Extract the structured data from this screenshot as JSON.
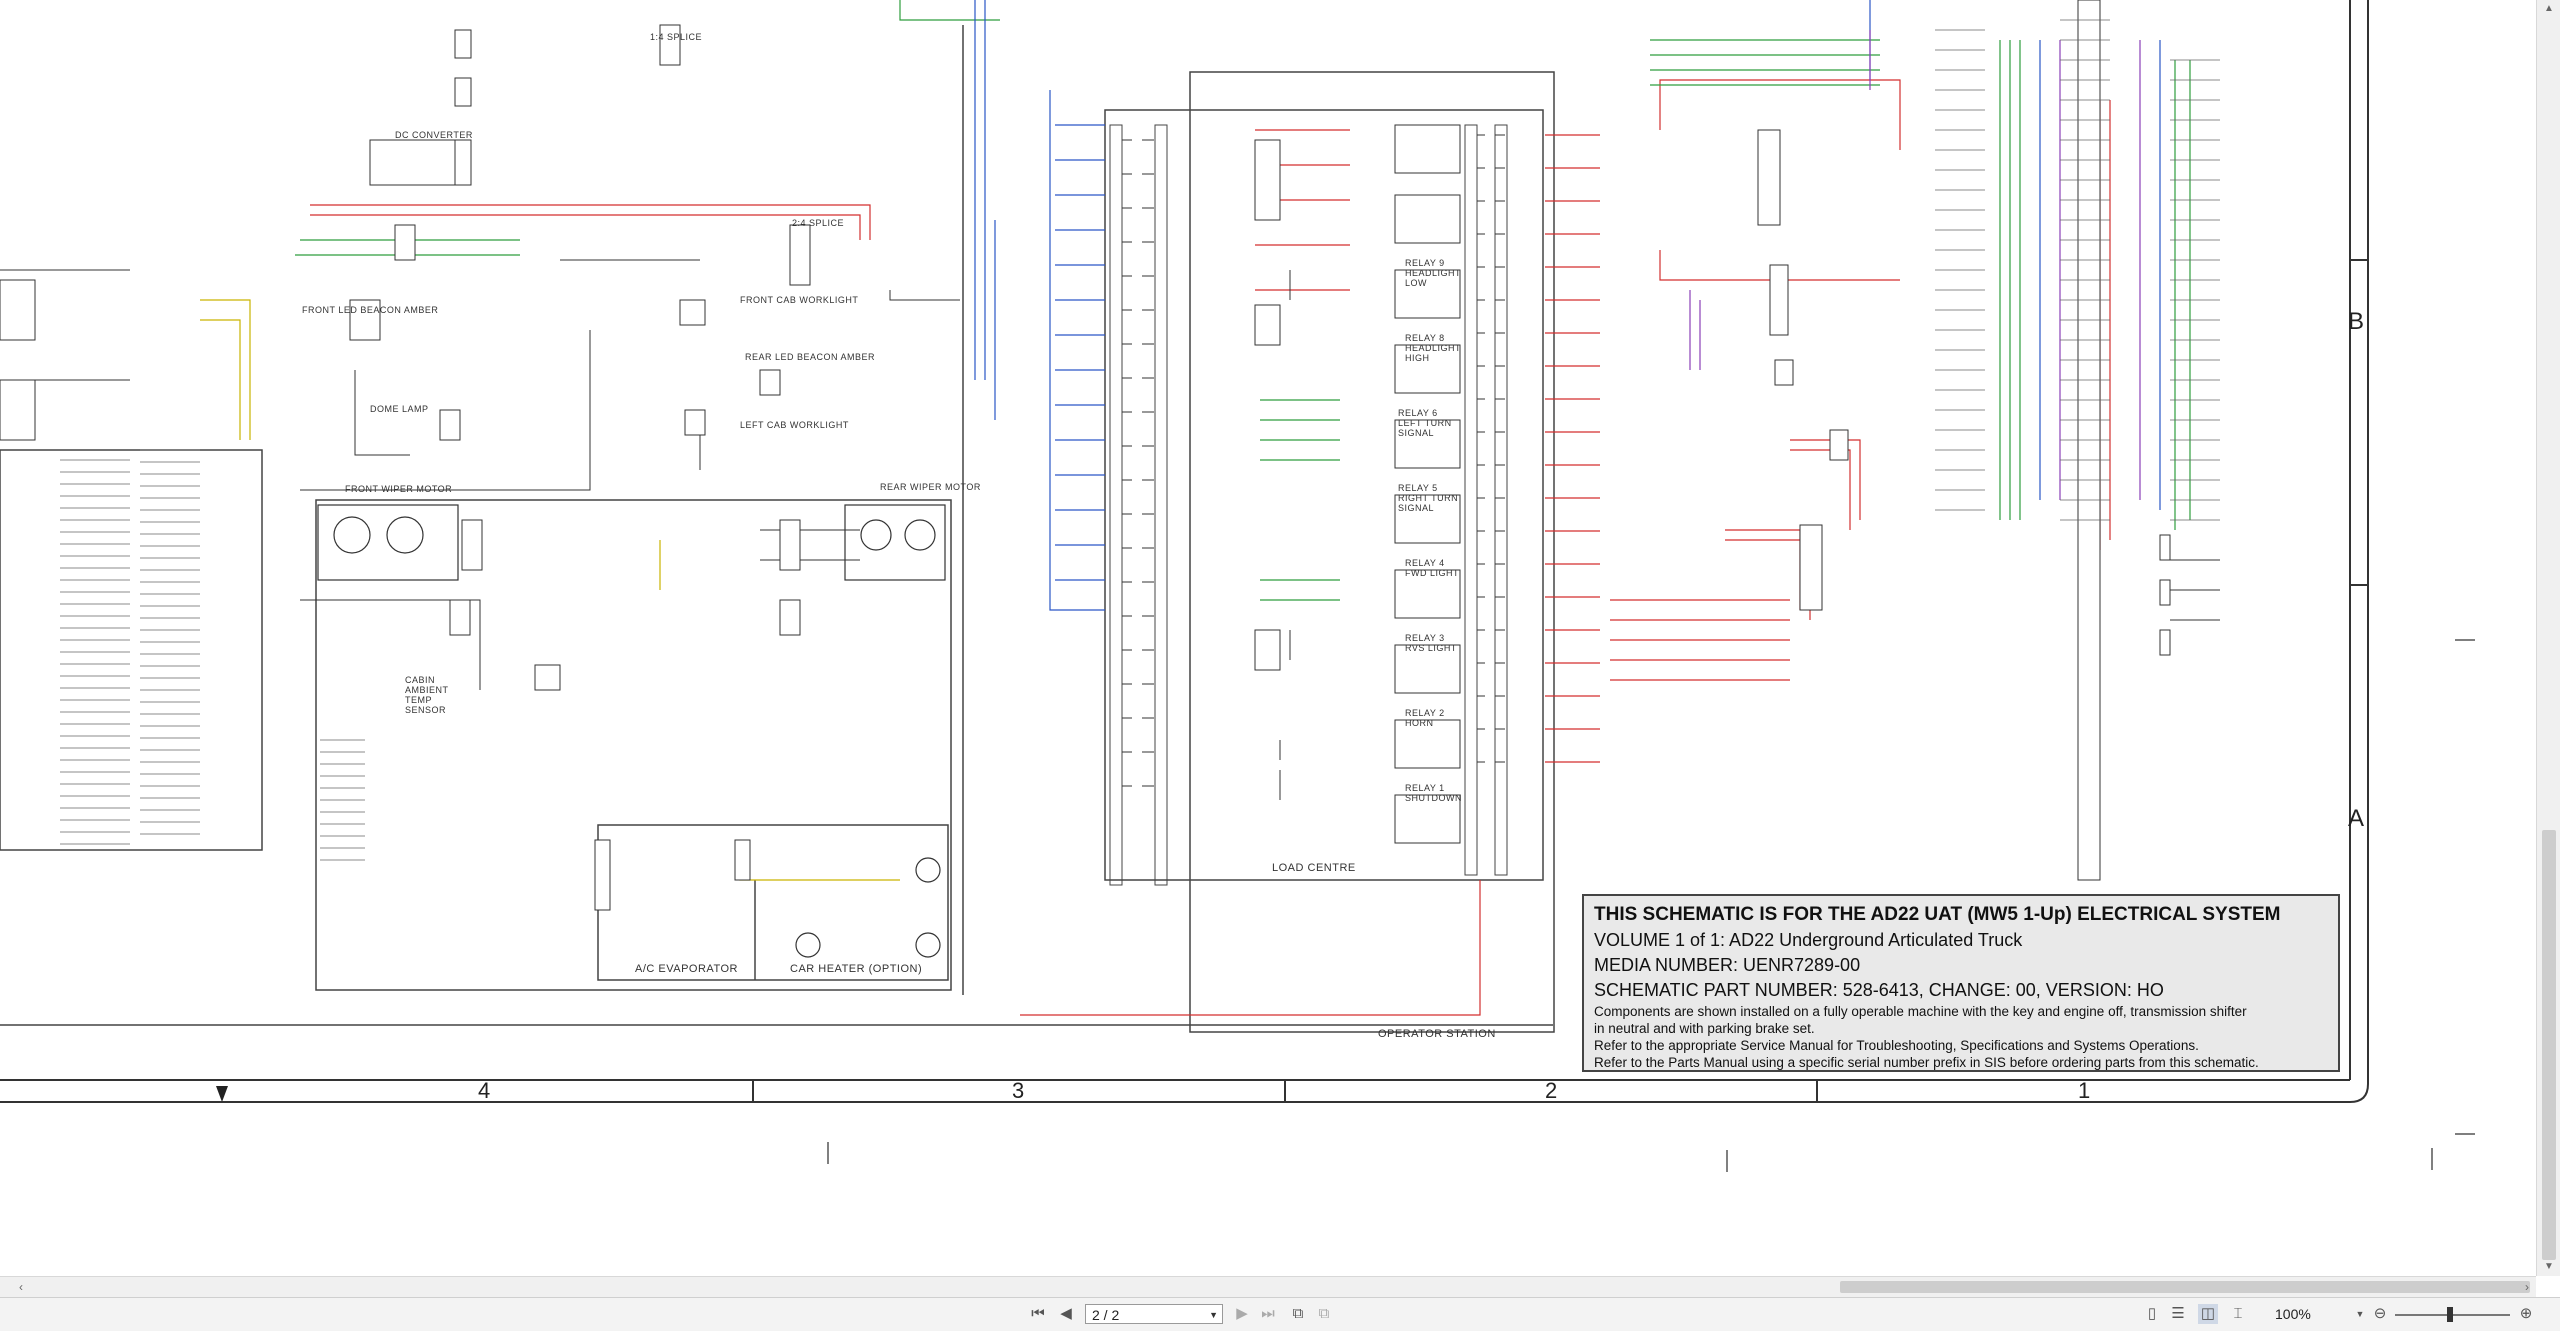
{
  "title_block": {
    "line1": "THIS SCHEMATIC IS FOR THE AD22  UAT (MW5 1-Up) ELECTRICAL SYSTEM",
    "line2": "VOLUME 1 of 1: AD22 Underground Articulated Truck",
    "line3": "MEDIA NUMBER: UENR7289-00",
    "line4": "SCHEMATIC PART NUMBER: 528-6413, CHANGE: 00, VERSION: HO",
    "line5": "Components are shown installed on a fully operable machine with the key and engine off, transmission shifter",
    "line6": "in neutral and with parking brake set.",
    "line7": "Refer to the appropriate Service Manual for Troubleshooting, Specifications and Systems Operations.",
    "line8": "Refer to the Parts Manual using a specific serial number prefix in SIS before ordering parts from this schematic."
  },
  "grid": {
    "rows": [
      "B",
      "A"
    ],
    "columns": [
      "4",
      "3",
      "2",
      "1"
    ]
  },
  "labels": {
    "load_centre": "LOAD CENTRE",
    "operator_station": "OPERATOR STATION",
    "ac_evaporator": "A/C EVAPORATOR",
    "car_heater": "CAR HEATER (OPTION)",
    "dc_converter": "DC CONVERTER",
    "front_wiper_motor": "FRONT WIPER MOTOR",
    "rear_wiper_motor": "REAR WIPER MOTOR",
    "front_cab_worklight": "FRONT CAB WORKLIGHT",
    "rear_led_beacon": "REAR LED BEACON AMBER",
    "left_cab_worklight": "LEFT CAB WORKLIGHT",
    "front_led_beacon": "FRONT LED BEACON AMBER",
    "dome_lamp": "DOME LAMP",
    "cabin_ambient_temp": "CABIN AMBIENT TEMP SENSOR",
    "splice_2": "2:4 SPLICE",
    "splice_1": "1:4 SPLICE",
    "relay_headlight_low": "RELAY 9 HEADLIGHT LOW",
    "relay_headlight_high": "RELAY 8 HEADLIGHT HIGH",
    "relay_left_turn": "RELAY 6 LEFT TURN SIGNAL",
    "relay_right_turn": "RELAY 5 RIGHT TURN SIGNAL",
    "relay_fwd_light": "RELAY 4 FWD LIGHT",
    "relay_rvs_light": "RELAY 3 RVS LIGHT",
    "relay_horn": "RELAY 2 HORN",
    "relay_shutdown": "RELAY 1 SHUTDOWN"
  },
  "toolbar": {
    "page_value": "2 / 2",
    "zoom_value": "100%"
  },
  "icons": {
    "first_page": "first-page-icon",
    "prev_page": "prev-page-icon",
    "next_page": "next-page-icon",
    "last_page": "last-page-icon",
    "fit_page": "fit-page-icon",
    "fit_width": "fit-width-icon",
    "single_page": "single-page-view-icon",
    "continuous": "continuous-view-icon",
    "two_page": "two-page-view-icon",
    "book_view": "book-view-icon",
    "zoom_out": "zoom-out-icon",
    "zoom_in": "zoom-in-icon"
  },
  "colors": {
    "wire_red": "#d32f2f",
    "wire_green": "#2e9e3e",
    "wire_blue": "#2a56c6",
    "wire_purple": "#8a3fb8",
    "wire_yellow": "#c9b400",
    "wire_black": "#222222",
    "title_block_bg": "#e9e9e9"
  }
}
